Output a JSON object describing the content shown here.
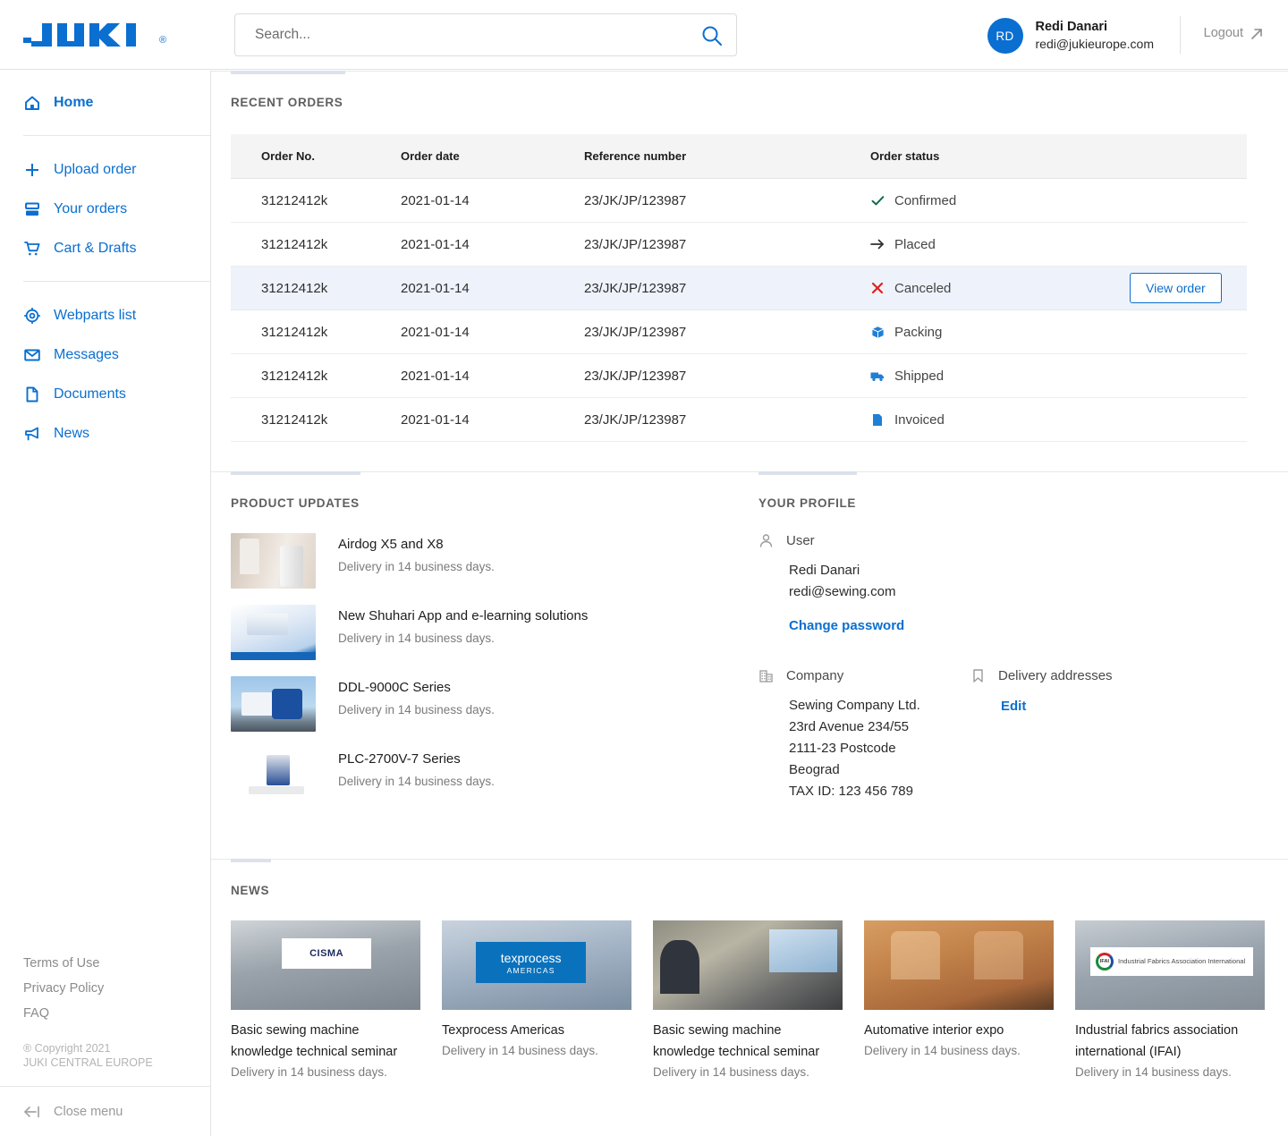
{
  "header": {
    "logo_text": "JUKI",
    "logo_registered": "®",
    "search_placeholder": "Search...",
    "search_value": "",
    "search_icon": "search-icon",
    "user": {
      "initials": "RD",
      "name": "Redi Danari",
      "email": "redi@jukieurope.com"
    },
    "logout_label": "Logout",
    "logout_icon": "external-link-arrow-icon"
  },
  "sidebar": {
    "group1": [
      {
        "label": "Home",
        "icon": "home-icon",
        "active": true
      }
    ],
    "group2": [
      {
        "label": "Upload order",
        "icon": "plus-icon"
      },
      {
        "label": "Your orders",
        "icon": "stacked-rows-icon"
      },
      {
        "label": "Cart & Drafts",
        "icon": "shopping-cart-icon"
      }
    ],
    "group3": [
      {
        "label": "Webparts list",
        "icon": "gear-icon"
      },
      {
        "label": "Messages",
        "icon": "envelope-icon"
      },
      {
        "label": "Documents",
        "icon": "document-icon"
      },
      {
        "label": "News",
        "icon": "megaphone-icon"
      }
    ],
    "footer_links": [
      "Terms of Use",
      "Privacy Policy",
      "FAQ"
    ],
    "copyright_line1": "® Copyright 2021",
    "copyright_line2": "JUKI CENTRAL EUROPE",
    "close_menu_label": "Close menu",
    "close_menu_icon": "arrow-left-bar-icon"
  },
  "recent_orders": {
    "title": "RECENT ORDERS",
    "columns": [
      "Order No.",
      "Order date",
      "Reference number",
      "Order status"
    ],
    "rows": [
      {
        "order_no": "31212412k",
        "order_date": "2021-01-14",
        "reference": "23/JK/JP/123987",
        "status": "Confirmed",
        "status_icon": "check-icon",
        "highlighted": false,
        "action": ""
      },
      {
        "order_no": "31212412k",
        "order_date": "2021-01-14",
        "reference": "23/JK/JP/123987",
        "status": "Placed",
        "status_icon": "arrow-right-icon",
        "highlighted": false,
        "action": ""
      },
      {
        "order_no": "31212412k",
        "order_date": "2021-01-14",
        "reference": "23/JK/JP/123987",
        "status": "Canceled",
        "status_icon": "cross-icon",
        "highlighted": true,
        "action": "View order"
      },
      {
        "order_no": "31212412k",
        "order_date": "2021-01-14",
        "reference": "23/JK/JP/123987",
        "status": "Packing",
        "status_icon": "box-icon",
        "highlighted": false,
        "action": ""
      },
      {
        "order_no": "31212412k",
        "order_date": "2021-01-14",
        "reference": "23/JK/JP/123987",
        "status": "Shipped",
        "status_icon": "truck-icon",
        "highlighted": false,
        "action": ""
      },
      {
        "order_no": "31212412k",
        "order_date": "2021-01-14",
        "reference": "23/JK/JP/123987",
        "status": "Invoiced",
        "status_icon": "invoice-icon",
        "highlighted": false,
        "action": ""
      }
    ],
    "view_order_label": "View order"
  },
  "product_updates": {
    "title": "PRODUCT UPDATES",
    "items": [
      {
        "title": "Airdog X5 and X8",
        "subtitle": "Delivery in 14 business days.",
        "image": "airdog-air-purifier-photo"
      },
      {
        "title": "New Shuhari App and e-learning solutions",
        "subtitle": "Delivery in 14 business days.",
        "image": "juki-shuhari-app-photo"
      },
      {
        "title": "DDL-9000C Series",
        "subtitle": "Delivery in 14 business days.",
        "image": "ddl-9000c-machine-photo"
      },
      {
        "title": "PLC-2700V-7 Series",
        "subtitle": "Delivery in 14 business days.",
        "image": "plc-2700v-machine-photo"
      }
    ]
  },
  "profile": {
    "title": "YOUR PROFILE",
    "user_section": {
      "label": "User",
      "icon": "person-icon",
      "name": "Redi Danari",
      "email": "redi@sewing.com",
      "change_password_label": "Change password"
    },
    "company_section": {
      "label": "Company",
      "icon": "building-icon",
      "lines": [
        "Sewing Company Ltd.",
        "23rd Avenue 234/55",
        "2111-23 Postcode",
        "Beograd",
        "TAX ID: 123 456 789"
      ]
    },
    "delivery_section": {
      "label": "Delivery addresses",
      "icon": "bookmark-icon",
      "edit_label": "Edit"
    }
  },
  "news": {
    "title": "NEWS",
    "cards": [
      {
        "title": "Basic sewing machine knowledge technical seminar",
        "subtitle": "Delivery in 14 business days.",
        "image": "cisma-expo-photo",
        "overlay_text": "CISMA"
      },
      {
        "title": "Texprocess Americas",
        "subtitle": "Delivery in 14 business days.",
        "image": "texprocess-americas-photo",
        "overlay_text": "texprocess",
        "overlay_text2": "AMERICAS"
      },
      {
        "title": "Basic sewing machine knowledge technical seminar",
        "subtitle": "Delivery in 14 business days.",
        "image": "sewing-technical-seminar-photo",
        "overlay_text": ""
      },
      {
        "title": "Automative interior expo",
        "subtitle": "Delivery in 14 business days.",
        "image": "automotive-interior-seats-photo",
        "overlay_text": ""
      },
      {
        "title": "Industrial fabrics association international (IFAI)",
        "subtitle": "Delivery in 14 business days.",
        "image": "ifai-expo-photo",
        "overlay_text": "IFAI",
        "overlay_text2": "Industrial Fabrics Association International"
      }
    ]
  },
  "colors": {
    "brand_blue": "#0a6fd0",
    "accent_bar": "#dce1eb",
    "row_highlight": "#eef2fa",
    "status_confirmed": "#0f6b52",
    "status_canceled": "#e02020",
    "table_header_bg": "#f4f4f4"
  }
}
